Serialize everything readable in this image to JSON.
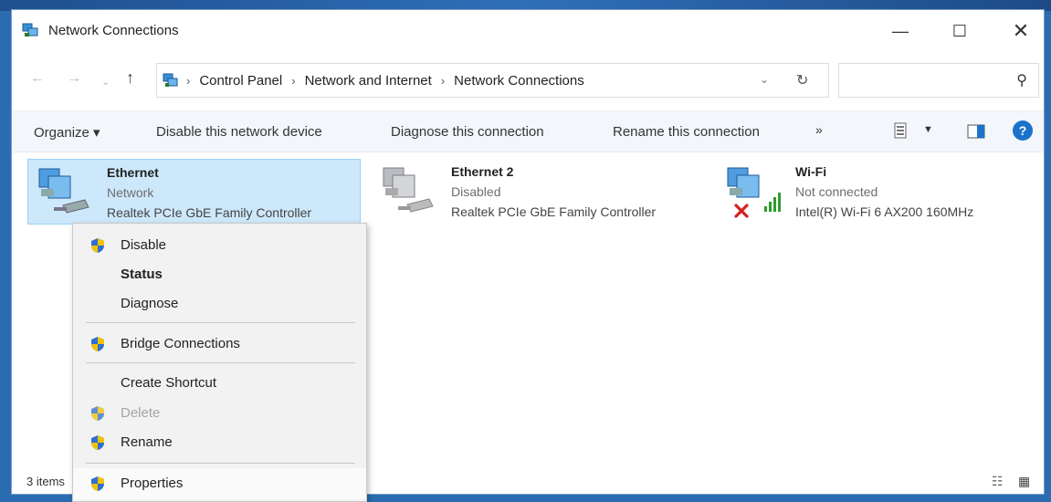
{
  "window": {
    "title": "Network Connections",
    "minimize_glyph": "—",
    "maximize_glyph": "☐",
    "close_glyph": "✕"
  },
  "address": {
    "breadcrumbs": [
      "Control Panel",
      "Network and Internet",
      "Network Connections"
    ],
    "separator": "›",
    "search_placeholder": ""
  },
  "commands": {
    "organize": "Organize ▾",
    "disable": "Disable this network device",
    "diagnose": "Diagnose this connection",
    "rename": "Rename this connection",
    "more": "»",
    "help": "?"
  },
  "connections": [
    {
      "name": "Ethernet",
      "status": "Network",
      "device": "Realtek PCIe GbE Family Controller",
      "selected": true
    },
    {
      "name": "Ethernet 2",
      "status": "Disabled",
      "device": "Realtek PCIe GbE Family Controller",
      "selected": false
    },
    {
      "name": "Wi-Fi",
      "status": "Not connected",
      "device": "Intel(R) Wi-Fi 6 AX200 160MHz",
      "selected": false
    }
  ],
  "context_menu": {
    "items": [
      {
        "label": "Disable",
        "shield": true,
        "bold": false,
        "disabled": false
      },
      {
        "label": "Status",
        "shield": false,
        "bold": true,
        "disabled": false
      },
      {
        "label": "Diagnose",
        "shield": false,
        "bold": false,
        "disabled": false
      },
      {
        "label": "Bridge Connections",
        "shield": true,
        "bold": false,
        "disabled": false
      },
      {
        "label": "Create Shortcut",
        "shield": false,
        "bold": false,
        "disabled": false
      },
      {
        "label": "Delete",
        "shield": true,
        "bold": false,
        "disabled": true
      },
      {
        "label": "Rename",
        "shield": true,
        "bold": false,
        "disabled": false
      },
      {
        "label": "Properties",
        "shield": true,
        "bold": false,
        "disabled": false
      }
    ]
  },
  "statusbar": {
    "count": "3 items"
  },
  "icons": {
    "title": "network-connections-icon",
    "shield": "uac-shield-icon",
    "wifi_error": "red-x-icon"
  },
  "colors": {
    "selection_bg": "#cde8fb",
    "selection_border": "#99d1f7",
    "accent": "#1a73c9"
  }
}
